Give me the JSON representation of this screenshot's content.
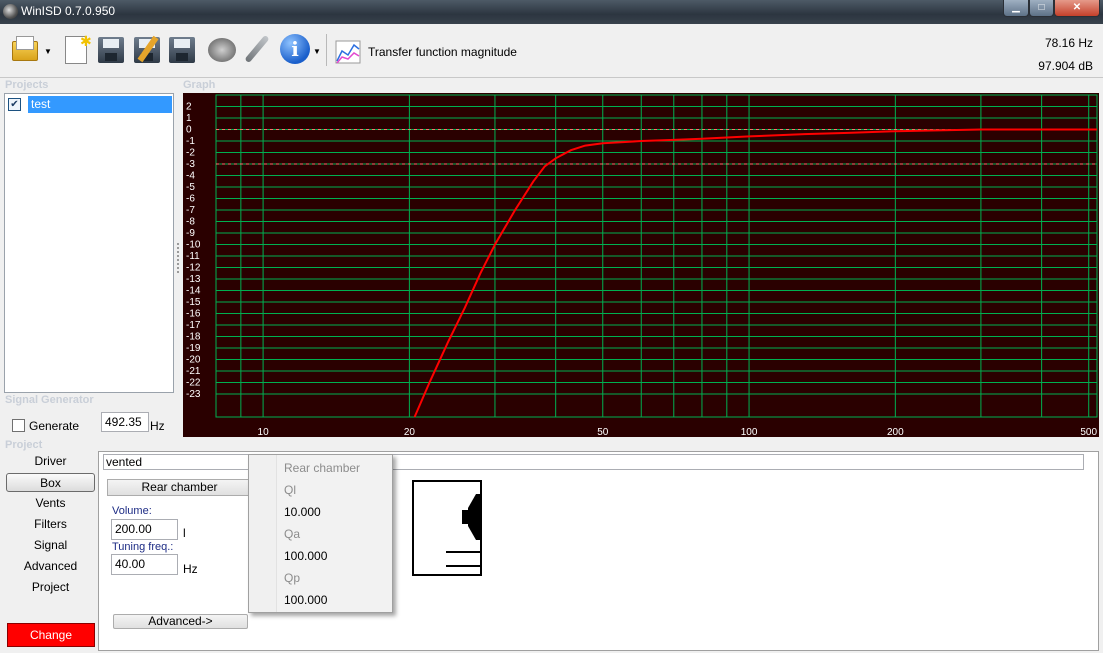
{
  "window": {
    "title": "WinISD 0.7.0.950",
    "min_label": "▁",
    "max_label": "□",
    "close_label": "✕"
  },
  "toolbar": {
    "icons": [
      "open-folder-icon",
      "new-project-icon",
      "save-icon",
      "save-as-icon",
      "save-all-icon",
      "driver-editor-icon",
      "tools-icon",
      "info-icon"
    ],
    "graph_type_label": "Transfer function magnitude",
    "cursor_freq": "78.16 Hz",
    "cursor_level": "97.904 dB"
  },
  "sections": {
    "projects": "Projects",
    "graph": "Graph",
    "signal_generator": "Signal Generator",
    "project": "Project"
  },
  "projects": {
    "items": [
      {
        "name": "test",
        "checked": true,
        "selected": true
      }
    ]
  },
  "signal_generator": {
    "generate_label": "Generate",
    "generate_checked": false,
    "frequency": "492.35",
    "unit": "Hz"
  },
  "nav": {
    "items": [
      "Driver",
      "Box",
      "Vents",
      "Filters",
      "Signal",
      "Advanced",
      "Project"
    ],
    "active": "Box"
  },
  "change_label": "Change",
  "box": {
    "type_value": "vented",
    "rear_chamber_tab": "Rear chamber",
    "volume_label": "Volume:",
    "volume_value": "200.00",
    "volume_unit": "l",
    "tuning_label": "Tuning freq.:",
    "tuning_value": "40.00",
    "tuning_unit": "Hz",
    "advanced_button": "Advanced->"
  },
  "popup": {
    "items": [
      {
        "label": "Rear chamber",
        "enabled": false
      },
      {
        "label": "Ql",
        "enabled": false
      },
      {
        "label": "10.000",
        "enabled": true
      },
      {
        "label": "Qa",
        "enabled": false
      },
      {
        "label": "100.000",
        "enabled": true
      },
      {
        "label": "Qp",
        "enabled": false
      },
      {
        "label": "100.000",
        "enabled": true
      }
    ]
  },
  "colors": {
    "graph_background": "#2a0000",
    "grid": "#00b050",
    "curve": "#ff0000",
    "reference": "#ff7070",
    "change_button": "#ff0000",
    "selection": "#3399ff"
  },
  "chart_data": {
    "type": "line",
    "title": "Transfer function magnitude",
    "xlabel": "",
    "ylabel": "",
    "x_scale": "log",
    "xlim": [
      8,
      520
    ],
    "ylim": [
      -25,
      3
    ],
    "x_ticks": [
      10,
      20,
      50,
      100,
      200,
      500
    ],
    "y_ticks": [
      2,
      1,
      0,
      -1,
      -2,
      -3,
      -4,
      -5,
      -6,
      -7,
      -8,
      -9,
      -10,
      -11,
      -12,
      -13,
      -14,
      -15,
      -16,
      -17,
      -18,
      -19,
      -20,
      -21,
      -22,
      -23
    ],
    "reference_lines_y": [
      0,
      -3
    ],
    "grid": true,
    "series": [
      {
        "values": [
          [
            20.5,
            -25
          ],
          [
            22,
            -22
          ],
          [
            24,
            -18.5
          ],
          [
            26,
            -15.5
          ],
          [
            28,
            -12.5
          ],
          [
            30,
            -10
          ],
          [
            33,
            -7
          ],
          [
            36,
            -4.5
          ],
          [
            38,
            -3.2
          ],
          [
            40,
            -2.5
          ],
          [
            43,
            -1.8
          ],
          [
            46,
            -1.4
          ],
          [
            50,
            -1.2
          ],
          [
            55,
            -1.1
          ],
          [
            60,
            -1.0
          ],
          [
            70,
            -0.9
          ],
          [
            80,
            -0.8
          ],
          [
            100,
            -0.6
          ],
          [
            130,
            -0.4
          ],
          [
            160,
            -0.3
          ],
          [
            200,
            -0.15
          ],
          [
            300,
            0
          ],
          [
            400,
            0
          ],
          [
            520,
            0
          ]
        ]
      }
    ]
  }
}
